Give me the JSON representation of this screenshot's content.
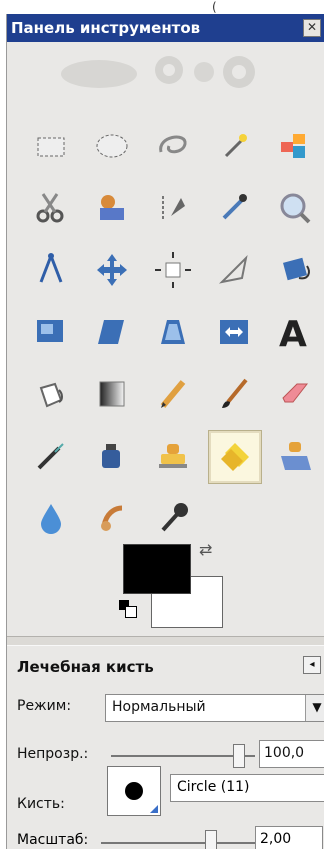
{
  "window": {
    "title": "Панель инструментов",
    "close_label": "✕"
  },
  "tools": [
    {
      "name": "rect-select-tool",
      "icon": "rectangle-select-icon"
    },
    {
      "name": "ellipse-select-tool",
      "icon": "ellipse-select-icon"
    },
    {
      "name": "free-select-tool",
      "icon": "lasso-icon"
    },
    {
      "name": "fuzzy-select-tool",
      "icon": "magic-wand-icon"
    },
    {
      "name": "color-select-tool",
      "icon": "color-select-icon"
    },
    {
      "name": "scissors-tool",
      "icon": "scissors-icon"
    },
    {
      "name": "foreground-select-tool",
      "icon": "foreground-select-icon"
    },
    {
      "name": "paths-tool",
      "icon": "pen-path-icon"
    },
    {
      "name": "color-picker-tool",
      "icon": "eyedropper-icon"
    },
    {
      "name": "zoom-tool",
      "icon": "magnifier-icon"
    },
    {
      "name": "measure-tool",
      "icon": "compass-icon"
    },
    {
      "name": "move-tool",
      "icon": "move-arrows-icon"
    },
    {
      "name": "align-tool",
      "icon": "align-icon"
    },
    {
      "name": "crop-tool",
      "icon": "knife-crop-icon"
    },
    {
      "name": "rotate-tool",
      "icon": "rotate-icon"
    },
    {
      "name": "scale-tool",
      "icon": "scale-icon"
    },
    {
      "name": "shear-tool",
      "icon": "shear-icon"
    },
    {
      "name": "perspective-tool",
      "icon": "perspective-icon"
    },
    {
      "name": "flip-tool",
      "icon": "flip-icon"
    },
    {
      "name": "text-tool",
      "icon": "text-icon"
    },
    {
      "name": "bucket-fill-tool",
      "icon": "bucket-icon"
    },
    {
      "name": "blend-tool",
      "icon": "gradient-icon"
    },
    {
      "name": "pencil-tool",
      "icon": "pencil-icon"
    },
    {
      "name": "paintbrush-tool",
      "icon": "paintbrush-icon"
    },
    {
      "name": "eraser-tool",
      "icon": "eraser-icon"
    },
    {
      "name": "airbrush-tool",
      "icon": "airbrush-icon"
    },
    {
      "name": "ink-tool",
      "icon": "ink-icon"
    },
    {
      "name": "clone-tool",
      "icon": "clone-stamp-icon"
    },
    {
      "name": "heal-tool",
      "icon": "heal-icon",
      "active": true
    },
    {
      "name": "perspective-clone-tool",
      "icon": "perspective-clone-icon"
    },
    {
      "name": "blur-tool",
      "icon": "droplet-icon"
    },
    {
      "name": "smudge-tool",
      "icon": "smudge-icon"
    },
    {
      "name": "dodge-burn-tool",
      "icon": "dodge-burn-icon"
    }
  ],
  "colors": {
    "foreground": "#000000",
    "background": "#ffffff"
  },
  "tool_options": {
    "title": "Лечебная кисть",
    "mode_label": "Режим:",
    "mode_value": "Нормальный",
    "opacity_label": "Непрозр.:",
    "opacity_value": "100,0",
    "opacity_fraction": 1.0,
    "brush_label": "Кисть:",
    "brush_value": "Circle (11)",
    "scale_label": "Масштаб:",
    "scale_value": "2,00"
  },
  "accent": {
    "titlebar": "#1f3f8f"
  }
}
